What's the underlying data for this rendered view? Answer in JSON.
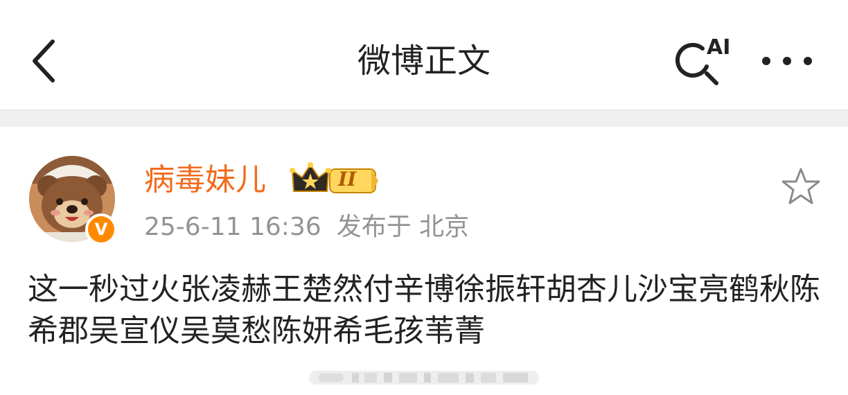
{
  "header": {
    "title": "微博正文",
    "back_icon": "chevron-left-icon",
    "ai_search_icon": "ai-search-icon",
    "ai_label": "AI",
    "more_icon": "more-horizontal-icon"
  },
  "post": {
    "author": "病毒妹儿",
    "vip_level": "II",
    "verify_mark": "V",
    "time": "25-6-11 16:36",
    "source": "发布于 北京",
    "text": "这一秒过火张凌赫王楚然付辛博徐振轩胡杏儿沙宝亮鹤秋陈希郡吴宣仪吴莫愁陈妍希毛孩苇菁",
    "favorite_icon": "star-outline-icon"
  },
  "colors": {
    "author": "#f36b1c",
    "meta": "#939393",
    "verify": "#ff8a00",
    "divider": "#efefef"
  }
}
